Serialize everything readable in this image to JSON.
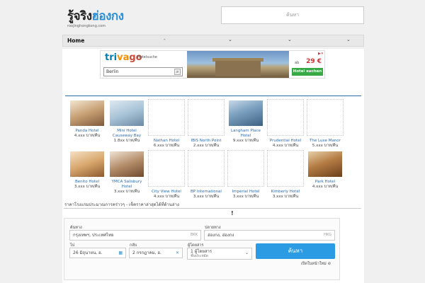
{
  "logo": {
    "main_a": "รู้จริง",
    "main_b": "ฮ่องกง",
    "sub": "roojinghongkong.com"
  },
  "search": {
    "text": "ค้นหา"
  },
  "nav": {
    "home": "Home",
    "dd1": "-",
    "dd2": "⌄",
    "dd3": "⌄",
    "dd4": "⌄"
  },
  "ad": {
    "brand_a": "tri",
    "brand_b": "va",
    "brand_c": "go",
    "hotelsuche": "Hotelsuche",
    "input": "Berlin",
    "ab": "ab",
    "price": "29 €",
    "button": "Hotel suchen >",
    "corner": "▶✕"
  },
  "hotels": [
    {
      "name": "Panda Hotel",
      "price": "4.xxx บาท/คืน"
    },
    {
      "name": "Mini Hotel Causeway Bay",
      "price": "1.8xx บาท/คืน"
    },
    {
      "name": "Nathan Hotel",
      "price": "6.xxx บาท/คืน"
    },
    {
      "name": "IBIS North Point",
      "price": "2.xxx บาท/คืน"
    },
    {
      "name": "Langham Place Hotel",
      "price": "9.xxx บาท/คืน"
    },
    {
      "name": "Prudential Hotel",
      "price": "4.xxx บาท/คืน"
    },
    {
      "name": "The Luxe Manor",
      "price": "5.xxx บาท/คืน"
    },
    {
      "name": "Benito Hotel",
      "price": "3.xxx บาท/คืน"
    },
    {
      "name": "YMCA Salisbury Hotel",
      "price": "3.xxx บาท/คืน"
    },
    {
      "name": "City View Hotel",
      "price": "4.xxx บาท/คืน"
    },
    {
      "name": "BP International",
      "price": "3.xxx บาท/คืน"
    },
    {
      "name": "Imperial Hotel",
      "price": "3.xxx บาท/คืน"
    },
    {
      "name": "Kimberly Hotel",
      "price": "3.xxx บาท/คืน"
    },
    {
      "name": "Park Hotel",
      "price": "4.xxx บาท/คืน"
    }
  ],
  "tagline": "ราคาโรงแรมประมาณการคร่าวๆ - เช็คราคาล่าสุดได้ที่ด้านล่าง",
  "excl": "!",
  "form": {
    "from_label": "ต้นทาง",
    "from_value": "กรุงเทพฯ, ประเทศไทย",
    "from_code": "BKK",
    "to_label": "ปลายทาง",
    "to_value": "ฮ่องกง, ฮ่องกง",
    "to_code": "HKG",
    "depart_label": "ไป",
    "depart_value": "26 มิถุนายน, อ.",
    "return_label": "กลับ",
    "return_value": "2 กรกฎาคม, อ.",
    "pax_label": "ผู้โดยสาร",
    "pax_value": "1 ผู้โดยสาร",
    "pax_sub": "ชั้นประหยัด",
    "search_button": "ค้นหา",
    "footer": "เปิดในหน้าใหม่ ⊘"
  }
}
